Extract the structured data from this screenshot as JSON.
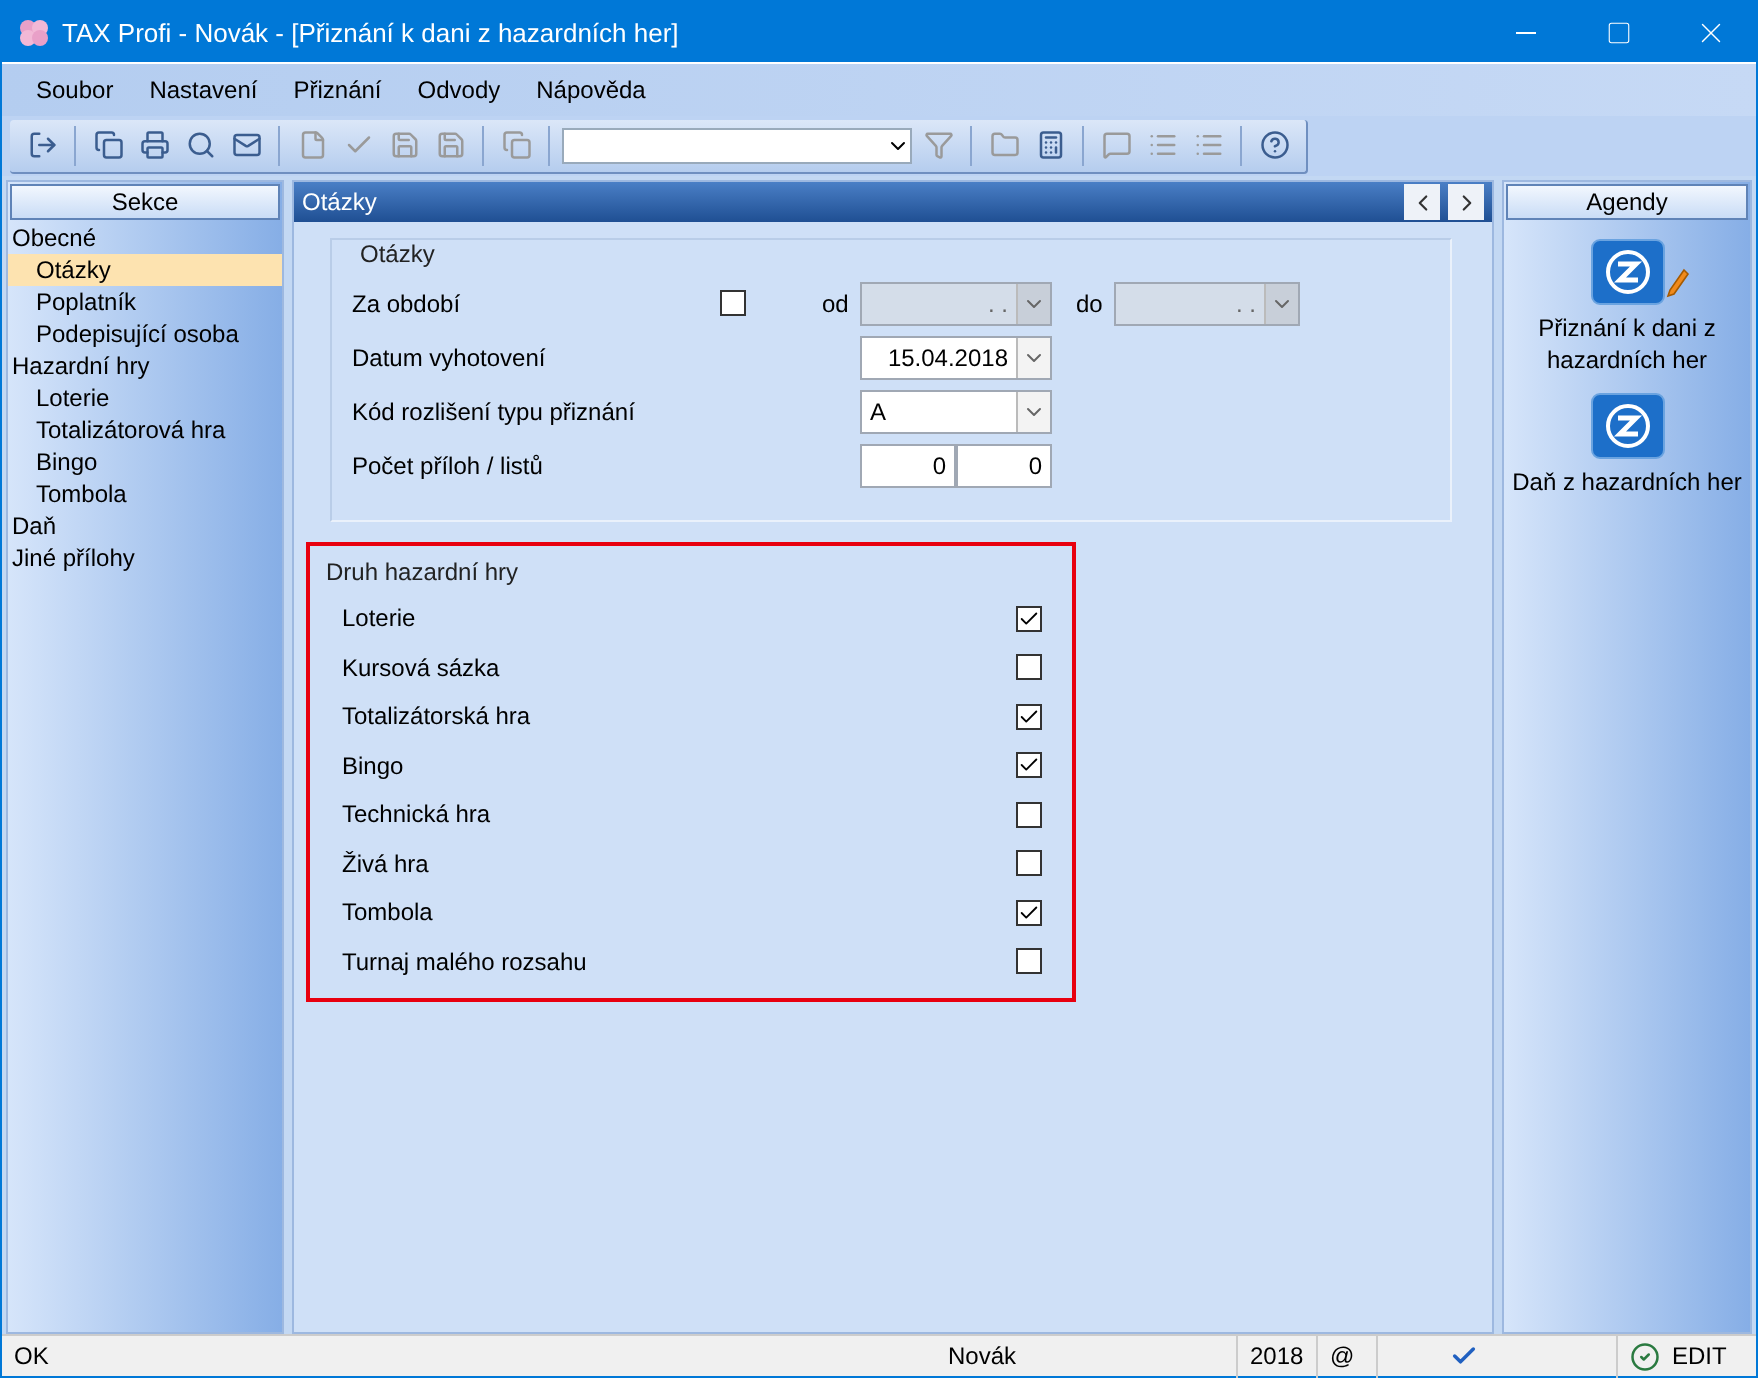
{
  "window": {
    "title": "TAX Profi - Novák - [Přiznání k dani z hazardních her]"
  },
  "menu": [
    {
      "label": "Soubor"
    },
    {
      "label": "Nastavení"
    },
    {
      "label": "Přiznání"
    },
    {
      "label": "Odvody"
    },
    {
      "label": "Nápověda"
    }
  ],
  "sections": {
    "title": "Sekce",
    "items": [
      {
        "label": "Obecné",
        "selected": false,
        "children": [
          {
            "label": "Otázky",
            "selected": true
          },
          {
            "label": "Poplatník",
            "selected": false
          },
          {
            "label": "Podepisující osoba",
            "selected": false
          }
        ]
      },
      {
        "label": "Hazardní hry",
        "selected": false,
        "children": [
          {
            "label": "Loterie",
            "selected": false
          },
          {
            "label": "Totalizátorová hra",
            "selected": false
          },
          {
            "label": "Bingo",
            "selected": false
          },
          {
            "label": "Tombola",
            "selected": false
          }
        ]
      },
      {
        "label": "Daň",
        "selected": false
      },
      {
        "label": "Jiné přílohy",
        "selected": false
      }
    ]
  },
  "panel": {
    "title": "Otázky"
  },
  "questions": {
    "title": "Otázky",
    "period": {
      "label": "Za období",
      "checked": false,
      "from_label": "od",
      "from_value": ". .",
      "to_label": "do",
      "to_value": ". .",
      "disabled": true
    },
    "date": {
      "label": "Datum vyhotovení",
      "value": "15.04.2018"
    },
    "code": {
      "label": "Kód rozlišení typu přiznání",
      "value": "A"
    },
    "attachments": {
      "label": "Počet příloh / listů",
      "values": [
        "0",
        "0"
      ]
    }
  },
  "games": {
    "title": "Druh hazardní hry",
    "items": [
      {
        "label": "Loterie",
        "checked": true
      },
      {
        "label": "Kursová sázka",
        "checked": false
      },
      {
        "label": "Totalizátorská hra",
        "checked": true
      },
      {
        "label": "Bingo",
        "checked": true
      },
      {
        "label": "Technická hra",
        "checked": false
      },
      {
        "label": "Živá hra",
        "checked": false
      },
      {
        "label": "Tombola",
        "checked": true
      },
      {
        "label": "Turnaj malého rozsahu",
        "checked": false
      }
    ]
  },
  "agendas": {
    "title": "Agendy",
    "items": [
      {
        "label": "Přiznání k dani z hazardních her",
        "edit": true
      },
      {
        "label": "Daň z hazardních her",
        "edit": false
      }
    ]
  },
  "status": {
    "message": "OK",
    "user": "Novák",
    "year": "2018",
    "at": "@",
    "mode": "EDIT"
  }
}
